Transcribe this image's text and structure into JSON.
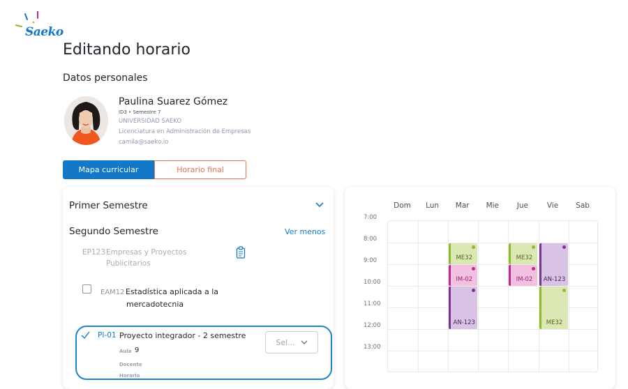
{
  "brand": {
    "name": "Saeko"
  },
  "page": {
    "title": "Editando horario",
    "section": "Datos personales"
  },
  "student": {
    "name": "Paulina Suarez Gómez",
    "meta": "ID3 • Semestre 7",
    "university": "UNIVERSIDAD SAEKO",
    "program": "Licenciatura en Administración de Empresas",
    "email": "camila@saeko.io"
  },
  "tabs": [
    {
      "label": "Mapa curricular",
      "active": true
    },
    {
      "label": "Horario final",
      "active": false
    }
  ],
  "curriculum": {
    "semester1": "Primer Semestre",
    "semester2": "Segundo Semestre",
    "toggle_label": "Ver menos",
    "courses": [
      {
        "code": "EP123",
        "name_line1": "Empresas y Proyectos",
        "name_line2": "Publicitarios",
        "state": "disabled"
      },
      {
        "code": "EAM12",
        "name_line1": "Estadística aplicada a la",
        "name_line2": "mercadotecnia",
        "state": "unchecked"
      },
      {
        "code": "PI-01",
        "name": "Proyecto integrador - 2 semestre",
        "state": "selected",
        "aula_label": "Aula",
        "aula_value": "9",
        "docente_label": "Docente",
        "horario_label": "Horario",
        "select_label": "Sel..."
      }
    ]
  },
  "schedule": {
    "days": [
      "Dom",
      "Lun",
      "Mar",
      "Mie",
      "Jue",
      "Vie",
      "Sab"
    ],
    "times": [
      "7:00",
      "8:00",
      "9:00",
      "10:00",
      "11:00",
      "12:00",
      "13:00"
    ],
    "events": [
      {
        "code": "ME32",
        "day": "Mar",
        "start": "8:00",
        "end": "9:00",
        "color": "green"
      },
      {
        "code": "IM-02",
        "day": "Mar",
        "start": "9:00",
        "end": "10:00",
        "color": "pink"
      },
      {
        "code": "AN-123",
        "day": "Mar",
        "start": "10:00",
        "end": "12:00",
        "color": "purple"
      },
      {
        "code": "ME32",
        "day": "Jue",
        "start": "8:00",
        "end": "9:00",
        "color": "green"
      },
      {
        "code": "IM-02",
        "day": "Jue",
        "start": "9:00",
        "end": "10:00",
        "color": "pink"
      },
      {
        "code": "AN-123",
        "day": "Vie",
        "start": "8:00",
        "end": "10:00",
        "color": "purple"
      },
      {
        "code": "ME32",
        "day": "Vie",
        "start": "10:00",
        "end": "12:00",
        "color": "green"
      }
    ]
  },
  "colors": {
    "accent": "#1478c8",
    "secondary": "#e8734e",
    "green": "#8dbb2b",
    "pink": "#c4288e",
    "purple": "#7b3394"
  }
}
